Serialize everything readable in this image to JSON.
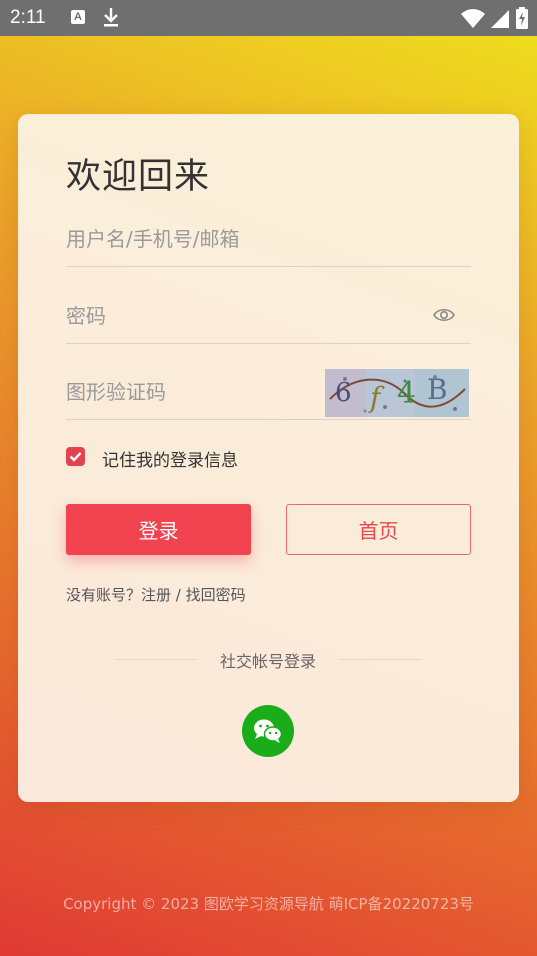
{
  "status_bar": {
    "time": "2:11",
    "a_icon": "A"
  },
  "login": {
    "title": "欢迎回来",
    "username_placeholder": "用户名/手机号/邮箱",
    "password_placeholder": "密码",
    "captcha_placeholder": "图形验证码",
    "captcha_text": "6f4B",
    "remember_label": "记住我的登录信息",
    "remember_checked": true,
    "login_button": "登录",
    "home_button": "首页",
    "no_account": "没有账号？",
    "register": "注册",
    "separator": " / ",
    "forgot": "找回密码",
    "social_label": "社交帐号登录"
  },
  "footer": {
    "copyright": "Copyright © 2023 图欧学习资源导航 萌ICP备20220723号"
  },
  "colors": {
    "accent": "#f0434f",
    "wechat": "#1aad19"
  },
  "icons": [
    "download-icon",
    "wifi-icon",
    "signal-icon",
    "battery-icon",
    "eye-icon",
    "check-icon",
    "wechat-icon"
  ]
}
